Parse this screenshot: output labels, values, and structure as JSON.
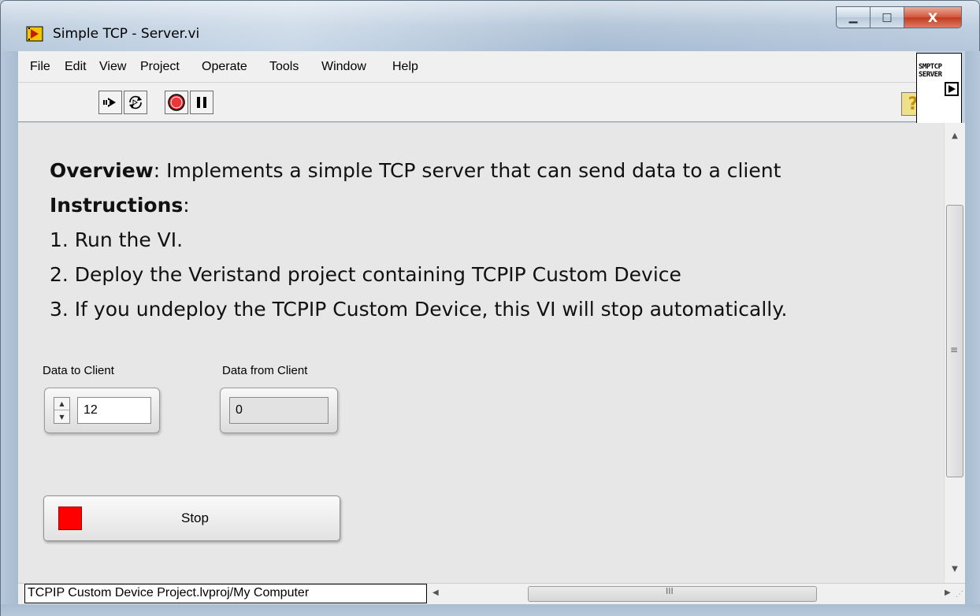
{
  "window": {
    "title": "Simple TCP - Server.vi",
    "minimize": "▁",
    "maximize": "□",
    "close": "X"
  },
  "menu": [
    "File",
    "Edit",
    "View",
    "Project",
    "Operate",
    "Tools",
    "Window",
    "Help"
  ],
  "toolbar": {
    "run_icon": "run-arrow-icon",
    "run_continuous_icon": "run-continuously-icon",
    "abort_icon": "abort-execution-icon",
    "pause_icon": "pause-icon",
    "help_label": "?"
  },
  "vi_icon": {
    "line1": "SMPTCP",
    "line2": "SERVER"
  },
  "panel": {
    "overview_label": "Overview",
    "overview_text": ": Implements a simple TCP server that can send data to a client",
    "instructions_label": "Instructions",
    "instructions_colon": ":",
    "step1": "1. Run the VI.",
    "step2": "2. Deploy the Veristand project containing TCPIP Custom Device",
    "step3": "3. If you undeploy the TCPIP Custom Device, this VI will stop automatically."
  },
  "controls": {
    "data_to_client_label": "Data to Client",
    "data_to_client_value": "12",
    "data_from_client_label": "Data from Client",
    "data_from_client_value": "0",
    "stop_label": "Stop",
    "stop_led_color": "#ff0000"
  },
  "status": {
    "context": "TCPIP Custom Device Project.lvproj/My Computer",
    "hscroll_grip": "III",
    "vscroll_grip": "≡"
  },
  "colors": {
    "panel_bg": "#e7e7e7",
    "help_bg": "#f0e08a"
  }
}
